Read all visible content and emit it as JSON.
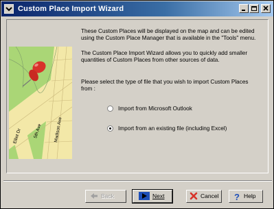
{
  "window": {
    "title": "Custom Place Import Wizard"
  },
  "intro": {
    "paragraph1": "These Custom Places will be displayed on the map and can be edited using the Custom Place Manager that is available in the \"Tools\" menu.",
    "paragraph2": "The Custom Place Import Wizard allows you to quickly add smaller quantities of Custom Places from other sources of data.",
    "paragraph3": "Please select the type of file that you wish to import Custom Places from :"
  },
  "options": [
    {
      "label": "Import from Microsoft Outlook",
      "selected": false
    },
    {
      "label": "Import from an existing file (including Excel)",
      "selected": true
    }
  ],
  "map": {
    "streets": [
      "Elliot Dr",
      "5th Ave",
      "Madison Ave"
    ]
  },
  "buttons": {
    "back": "Back",
    "next": "Next",
    "cancel": "Cancel",
    "help": "Help"
  },
  "colors": {
    "title_start": "#0a246a",
    "title_end": "#a6caf0",
    "pin": "#d8332a",
    "park": "#9fd06a",
    "road": "#f3e8a8"
  }
}
